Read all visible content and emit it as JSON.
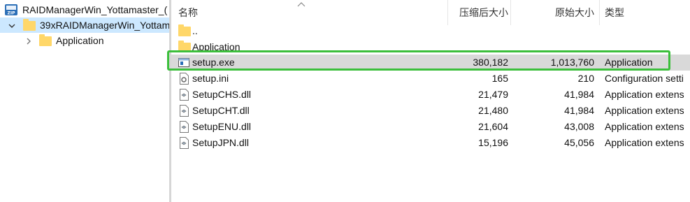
{
  "tree": {
    "root_label": "RAIDManagerWin_Yottamaster_(",
    "selected_label": "39xRAIDManagerWin_Yottam",
    "child_label": "Application",
    "zip_badge": "ZIP"
  },
  "columns": {
    "name": "名称",
    "compressed": "压缩后大小",
    "original": "原始大小",
    "type": "类型"
  },
  "rows": [
    {
      "name": "..",
      "compressed": "",
      "original": "",
      "type": "",
      "icon": "folder-icon"
    },
    {
      "name": "Application",
      "compressed": "",
      "original": "",
      "type": "",
      "icon": "folder-icon"
    },
    {
      "name": "setup.exe",
      "compressed": "380,182",
      "original": "1,013,760",
      "type": "Application",
      "icon": "exe-icon"
    },
    {
      "name": "setup.ini",
      "compressed": "165",
      "original": "210",
      "type": "Configuration setti",
      "icon": "ini-icon"
    },
    {
      "name": "SetupCHS.dll",
      "compressed": "21,479",
      "original": "41,984",
      "type": "Application extens",
      "icon": "dll-icon"
    },
    {
      "name": "SetupCHT.dll",
      "compressed": "21,480",
      "original": "41,984",
      "type": "Application extens",
      "icon": "dll-icon"
    },
    {
      "name": "SetupENU.dll",
      "compressed": "21,604",
      "original": "43,008",
      "type": "Application extens",
      "icon": "dll-icon"
    },
    {
      "name": "SetupJPN.dll",
      "compressed": "15,196",
      "original": "45,056",
      "type": "Application extens",
      "icon": "dll-icon"
    }
  ],
  "colors": {
    "tree_selection": "#cce8ff",
    "row_selection": "#d9d9d9",
    "highlight_border": "#3cbf3c",
    "folder": "#ffd769"
  }
}
